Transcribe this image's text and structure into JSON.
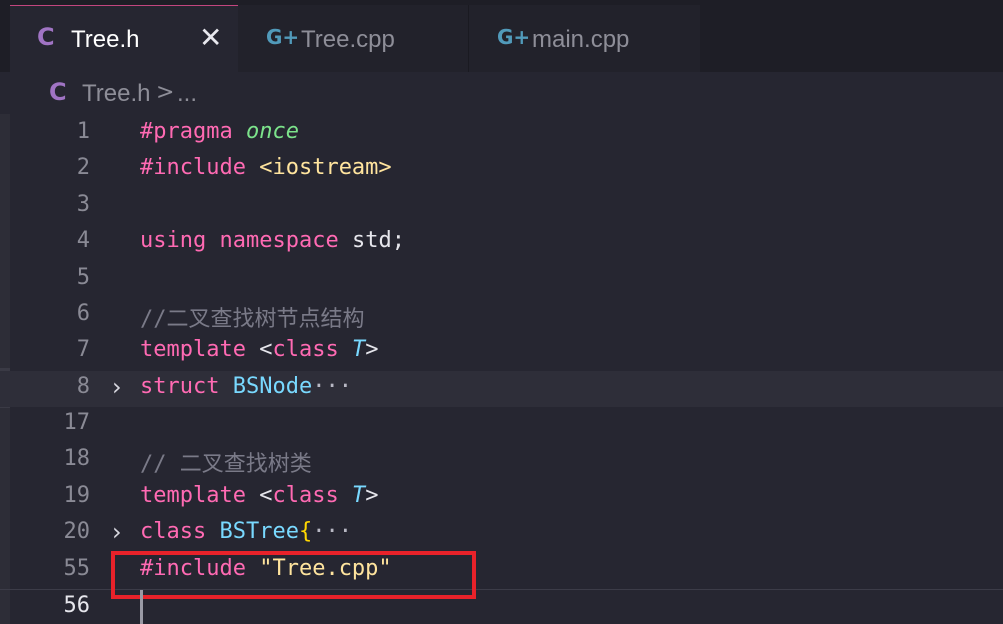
{
  "tabs": [
    {
      "icon": "C",
      "label": "Tree.h",
      "active": true,
      "close": "✕"
    },
    {
      "icon": "G+",
      "label": "Tree.cpp",
      "active": false
    },
    {
      "icon": "G+",
      "label": "main.cpp",
      "active": false
    }
  ],
  "breadcrumb": {
    "icon": "C",
    "file": "Tree.h",
    "separator": ">",
    "more": "..."
  },
  "lines": [
    {
      "num": "1",
      "text": "#pragma once"
    },
    {
      "num": "2",
      "text": "#include <iostream>"
    },
    {
      "num": "3",
      "text": ""
    },
    {
      "num": "4",
      "text": "using namespace std;"
    },
    {
      "num": "5",
      "text": ""
    },
    {
      "num": "6",
      "text": "//二叉查找树节点结构"
    },
    {
      "num": "7",
      "text": "template <class T>"
    },
    {
      "num": "8",
      "text": "struct BSNode···",
      "folded": true
    },
    {
      "num": "17",
      "text": ""
    },
    {
      "num": "18",
      "text": "// 二叉查找树类"
    },
    {
      "num": "19",
      "text": "template <class T>"
    },
    {
      "num": "20",
      "text": "class BSTree{···",
      "folded": true
    },
    {
      "num": "55",
      "text": "#include \"Tree.cpp\""
    },
    {
      "num": "56",
      "text": ""
    }
  ],
  "tokens": {
    "pragma": "#pragma",
    "once": "once",
    "include": "#include",
    "iostream": "<iostream>",
    "using": "using",
    "namespace": "namespace",
    "std": "std;",
    "comment6": "//二叉查找树节点结构",
    "template": "template",
    "lt": "<",
    "class": "class",
    "T": "T",
    "gt": ">",
    "struct": "struct",
    "BSNode": "BSNode",
    "ellipsis": "···",
    "comment18": "// 二叉查找树类",
    "BSTree": "BSTree",
    "brace": "{",
    "treecpp": "\"Tree.cpp\"",
    "fold": "›"
  },
  "colors": {
    "keyword": "#ff6ab3",
    "string": "#ffe49e",
    "type": "#79d9ff",
    "comment": "#7a7a88",
    "highlight_box": "#e8222a"
  }
}
